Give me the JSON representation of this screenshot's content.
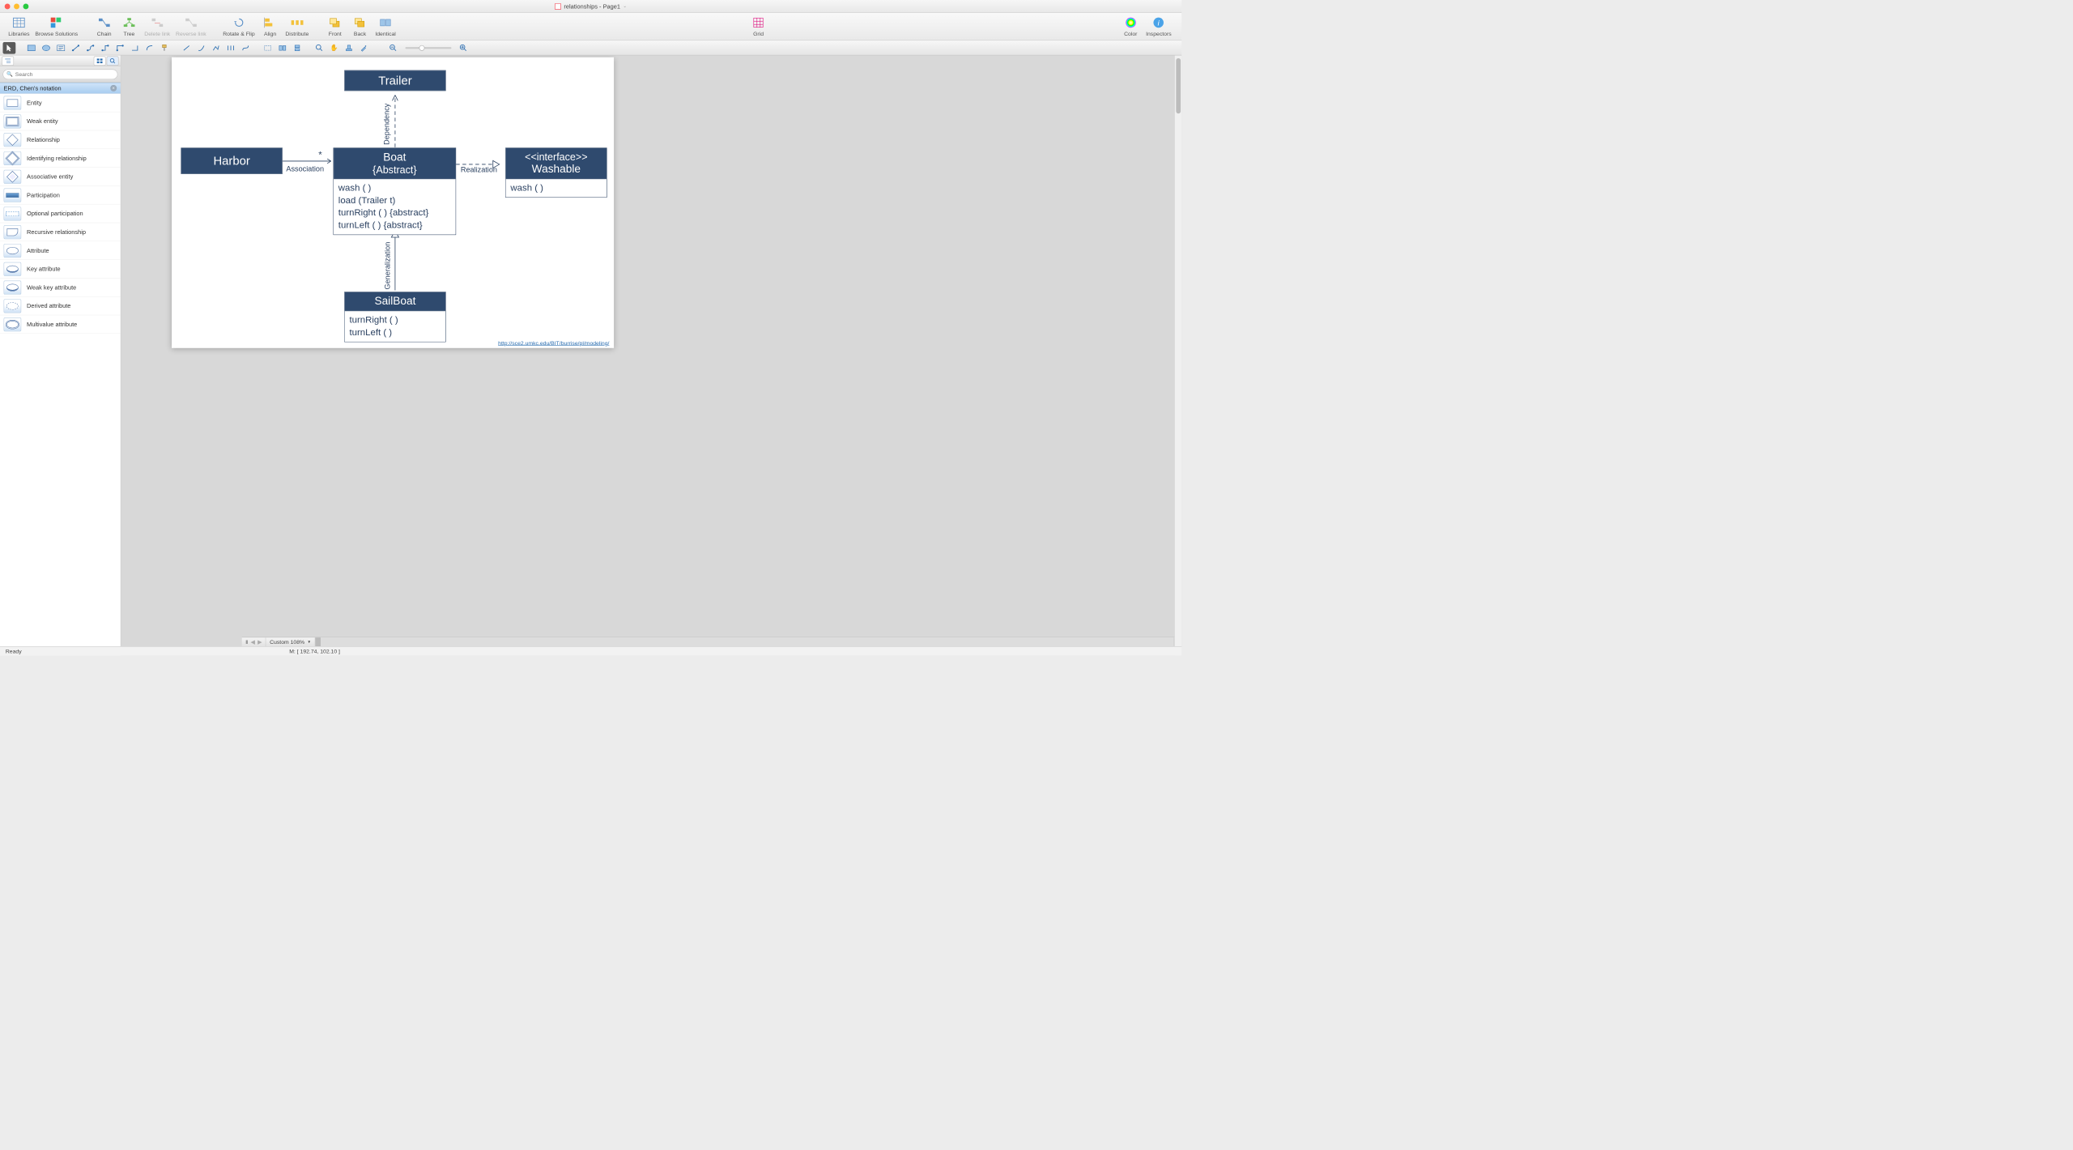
{
  "title": "relationships - Page1",
  "toolbar": {
    "libraries": "Libraries",
    "browse": "Browse Solutions",
    "chain": "Chain",
    "tree": "Tree",
    "delete_link": "Delete link",
    "reverse_link": "Reverse link",
    "rotate_flip": "Rotate & Flip",
    "align": "Align",
    "distribute": "Distribute",
    "front": "Front",
    "back": "Back",
    "identical": "Identical",
    "grid": "Grid",
    "color": "Color",
    "inspectors": "Inspectors"
  },
  "search_placeholder": "Search",
  "library": {
    "title": "ERD, Chen's notation",
    "items": [
      "Entity",
      "Weak entity",
      "Relationship",
      "Identifying relationship",
      "Associative entity",
      "Participation",
      "Optional participation",
      "Recursive relationship",
      "Attribute",
      "Key attribute",
      "Weak key attribute",
      "Derived attribute",
      "Multivalue attribute"
    ]
  },
  "diagram": {
    "trailer": "Trailer",
    "harbor": "Harbor",
    "boat_title": "Boat",
    "boat_sub": "{Abstract}",
    "boat_ops": "wash ( )\nload (Trailer t)\nturnRight ( ) {abstract}\nturnLeft ( ) {abstract}",
    "interface_stereo": "<<interface>>",
    "interface_name": "Washable",
    "interface_ops": "wash ( )",
    "sailboat": "SailBoat",
    "sailboat_ops": "turnRight ( )\nturnLeft ( )",
    "assoc_label": "Association",
    "assoc_mult": "*",
    "dep_label": "Dependency",
    "real_label": "Realization",
    "gen_label": "Generalization",
    "footer_url": "http://sce2.umkc.edu/BIT/burrise/pl/modeling/"
  },
  "bottom": {
    "zoom": "Custom 108%",
    "coords": "M: [ 192.74, 102.10 ]",
    "status": "Ready"
  }
}
